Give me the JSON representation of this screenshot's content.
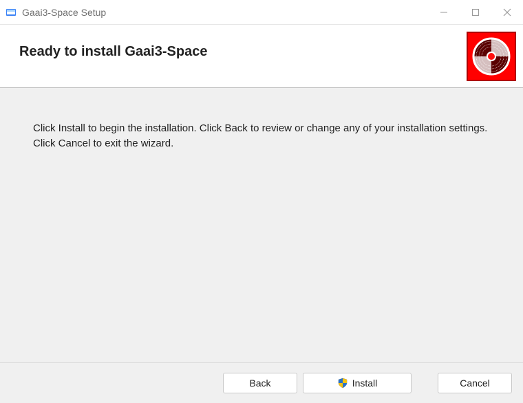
{
  "window": {
    "title": "Gaai3-Space Setup"
  },
  "header": {
    "heading": "Ready to install Gaai3-Space"
  },
  "content": {
    "body_text": "Click Install to begin the installation. Click Back to review or change any of your installation settings. Click Cancel to exit the wizard."
  },
  "footer": {
    "back_label": "Back",
    "install_label": "Install",
    "cancel_label": "Cancel"
  },
  "icons": {
    "app": "installer-app-icon",
    "brand": "disc-icon",
    "shield": "uac-shield-icon",
    "minimize": "minimize-icon",
    "maximize": "maximize-icon",
    "close": "close-icon"
  }
}
